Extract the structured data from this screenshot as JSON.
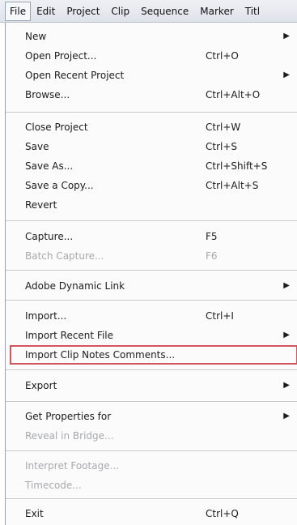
{
  "menubar": {
    "items": [
      "File",
      "Edit",
      "Project",
      "Clip",
      "Sequence",
      "Marker",
      "Titl"
    ]
  },
  "menu": {
    "new": {
      "label": "New",
      "submenu": true
    },
    "open_project": {
      "label": "Open Project...",
      "shortcut": "Ctrl+O"
    },
    "open_recent_project": {
      "label": "Open Recent Project",
      "submenu": true
    },
    "browse": {
      "label": "Browse...",
      "shortcut": "Ctrl+Alt+O"
    },
    "close_project": {
      "label": "Close Project",
      "shortcut": "Ctrl+W"
    },
    "save": {
      "label": "Save",
      "shortcut": "Ctrl+S"
    },
    "save_as": {
      "label": "Save As...",
      "shortcut": "Ctrl+Shift+S"
    },
    "save_copy": {
      "label": "Save a Copy...",
      "shortcut": "Ctrl+Alt+S"
    },
    "revert": {
      "label": "Revert"
    },
    "capture": {
      "label": "Capture...",
      "shortcut": "F5"
    },
    "batch_capture": {
      "label": "Batch Capture...",
      "shortcut": "F6",
      "disabled": true
    },
    "dynamic_link": {
      "label": "Adobe Dynamic Link",
      "submenu": true
    },
    "import": {
      "label": "Import...",
      "shortcut": "Ctrl+I"
    },
    "import_recent": {
      "label": "Import Recent File",
      "submenu": true
    },
    "import_clip_notes": {
      "label": "Import Clip Notes Comments...",
      "highlighted": true
    },
    "export": {
      "label": "Export",
      "submenu": true
    },
    "get_properties": {
      "label": "Get Properties for",
      "submenu": true
    },
    "reveal_in_bridge": {
      "label": "Reveal in Bridge...",
      "disabled": true
    },
    "interpret_footage": {
      "label": "Interpret Footage...",
      "disabled": true
    },
    "timecode": {
      "label": "Timecode...",
      "disabled": true
    },
    "exit": {
      "label": "Exit",
      "shortcut": "Ctrl+Q"
    },
    "submenu_arrow": "▶"
  }
}
